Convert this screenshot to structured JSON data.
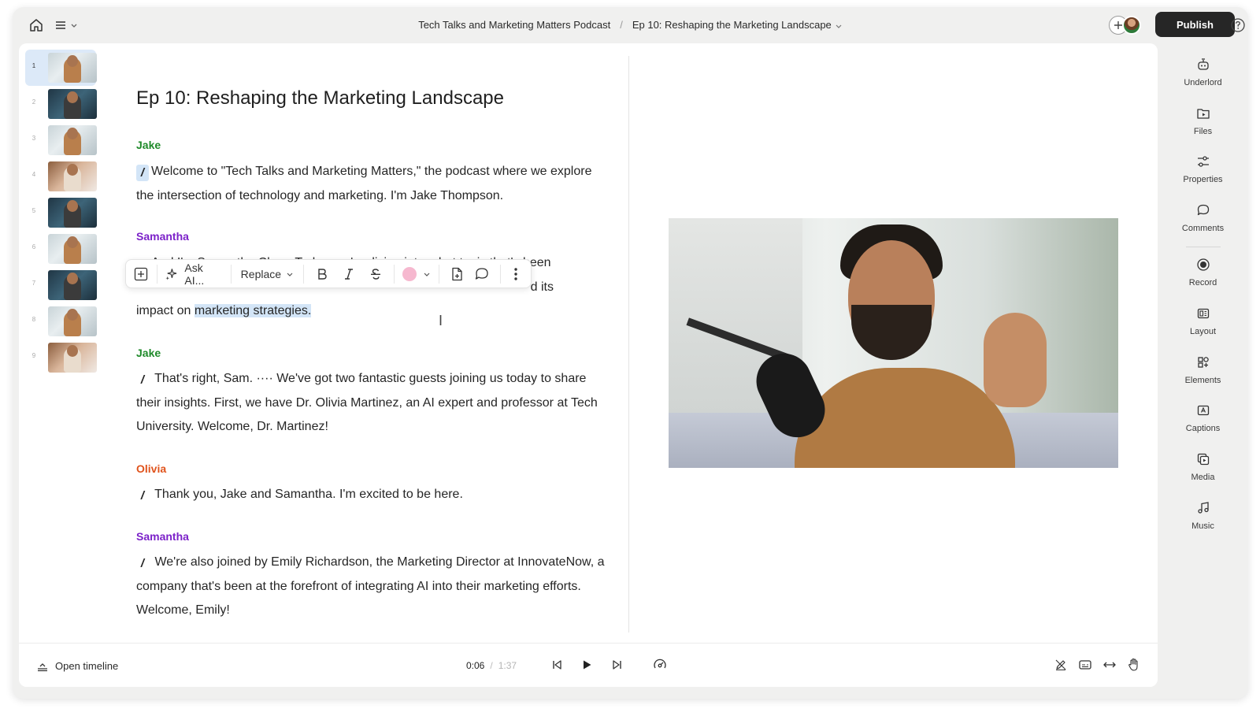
{
  "topbar": {
    "project": "Tech Talks and Marketing Matters Podcast",
    "separator": "/",
    "episode": "Ep 10: Reshaping the Marketing Landscape",
    "publish_label": "Publish"
  },
  "scenes": [
    {
      "num": "1",
      "style": "t1"
    },
    {
      "num": "2",
      "style": "t2"
    },
    {
      "num": "3",
      "style": "t1"
    },
    {
      "num": "4",
      "style": "t3"
    },
    {
      "num": "5",
      "style": "t2"
    },
    {
      "num": "6",
      "style": "t1"
    },
    {
      "num": "7",
      "style": "t2"
    },
    {
      "num": "8",
      "style": "t1"
    },
    {
      "num": "9",
      "style": "t3"
    }
  ],
  "document": {
    "title": "Ep 10: Reshaping the Marketing Landscape",
    "speakers": {
      "jake": {
        "name": "Jake",
        "color": "#1f8a2a"
      },
      "samantha": {
        "name": "Samantha",
        "color": "#7c22c9"
      },
      "olivia": {
        "name": "Olivia",
        "color": "#e0531c"
      }
    },
    "blocks": [
      {
        "speaker": "Jake",
        "text": "Welcome to \"Tech Talks and Marketing Matters,\" the podcast where we explore the intersection of technology and marketing. I'm Jake Thompson."
      },
      {
        "speaker": "Samantha",
        "text_before": "And I'm Samantha Chen. Today, we're diving into a hot topic that's been",
        "text_partial_end": "d its",
        "text_after": "impact on ",
        "selected": "marketing strategies."
      },
      {
        "speaker": "Jake",
        "text": "That's right, Sam. ···· We've got two fantastic guests joining us today to share their insights. First, we have Dr. Olivia Martinez, an AI expert and professor at Tech University. Welcome, Dr. Martinez!"
      },
      {
        "speaker": "Olivia",
        "text": "Thank you, Jake and Samantha. I'm excited to be here."
      },
      {
        "speaker": "Samantha",
        "text": "We're also joined by Emily Richardson, the Marketing Director at InnovateNow, a company that's been at the forefront of integrating AI into their marketing efforts. Welcome, Emily!"
      }
    ]
  },
  "format_toolbar": {
    "ask_ai": "Ask AI...",
    "replace": "Replace",
    "highlight_color": "#f6b8cf"
  },
  "rail": [
    {
      "label": "Underlord",
      "icon": "robot-icon"
    },
    {
      "label": "Files",
      "icon": "file-play-icon"
    },
    {
      "label": "Properties",
      "icon": "sliders-icon"
    },
    {
      "label": "Comments",
      "icon": "comment-icon"
    },
    {
      "label": "Record",
      "icon": "record-icon"
    },
    {
      "label": "Layout",
      "icon": "layout-icon"
    },
    {
      "label": "Elements",
      "icon": "elements-icon"
    },
    {
      "label": "Captions",
      "icon": "captions-icon"
    },
    {
      "label": "Media",
      "icon": "media-icon"
    },
    {
      "label": "Music",
      "icon": "music-icon"
    }
  ],
  "bottom": {
    "open_timeline": "Open timeline",
    "current_time": "0:06",
    "time_sep": "/",
    "duration": "1:37"
  }
}
